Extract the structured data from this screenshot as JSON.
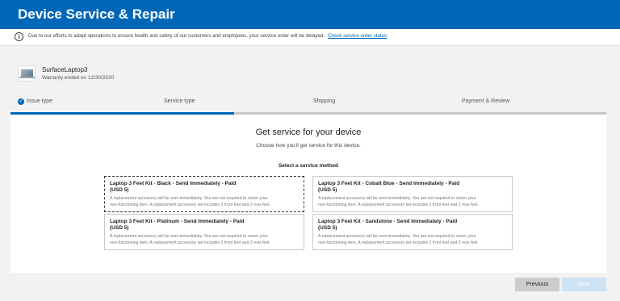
{
  "header": {
    "title": "Device Service & Repair"
  },
  "notice": {
    "text": "Due to our efforts to adapt operations to ensure health and safety of our customers and employees, your service order will be delayed.",
    "link": "Check service order status"
  },
  "device": {
    "name": "SurfaceLaptop3",
    "warranty": "Warranty ended on 12/30/2020"
  },
  "steps": [
    {
      "label": "Issue type",
      "status": "complete"
    },
    {
      "label": "Service type",
      "status": "current"
    },
    {
      "label": "Shipping",
      "status": "upcoming"
    },
    {
      "label": "Payment & Review",
      "status": "upcoming"
    }
  ],
  "main": {
    "title": "Get service for your device",
    "subtitle": "Choose how you'll get service for this device.",
    "method_label": "Select a service method",
    "options": [
      {
        "title": "Laptop 3 Feet Kit - Black - Send Immediately - Paid",
        "price": "(USD 5)",
        "desc1": "A replacement accessory will be sent immediately. You are not required to return your",
        "desc2": "non-functioning item. A replacement accessory set includes 2 front feet and 2 rear feet.",
        "selected": true
      },
      {
        "title": "Laptop 3 Feet Kit - Cobalt Blue - Send Immediately - Paid",
        "price": "(USD 5)",
        "desc1": "A replacement accessory will be sent immediately. You are not required to return your",
        "desc2": "non-functioning item. A replacement accessory set includes 2 front feet and 2 rear feet.",
        "selected": false
      },
      {
        "title": "Laptop 3 Feet Kit - Platinum - Send Immediately - Paid",
        "price": "(USD 5)",
        "desc1": "A replacement accessory will be sent immediately. You are not required to return your",
        "desc2": "non-functioning item. A replacement accessory set includes 2 front feet and 2 rear feet.",
        "selected": false
      },
      {
        "title": "Laptop 3 Feet Kit - Sandstone - Send Immediately - Paid",
        "price": "(USD 5)",
        "desc1": "A replacement accessory will be sent immediately. You are not required to return your",
        "desc2": "non-functioning item. A replacement accessory set includes 2 front feet and 2 rear feet.",
        "selected": false
      }
    ]
  },
  "footer": {
    "previous_label": "Previous",
    "next_label": "Next"
  },
  "colors": {
    "brand": "#0067b8",
    "progress_track": "#c8c8c8",
    "next_disabled": "#cde3f5"
  },
  "icons": {
    "notice": "info-icon",
    "step_complete": "check-circle-icon",
    "device": "laptop-icon"
  }
}
